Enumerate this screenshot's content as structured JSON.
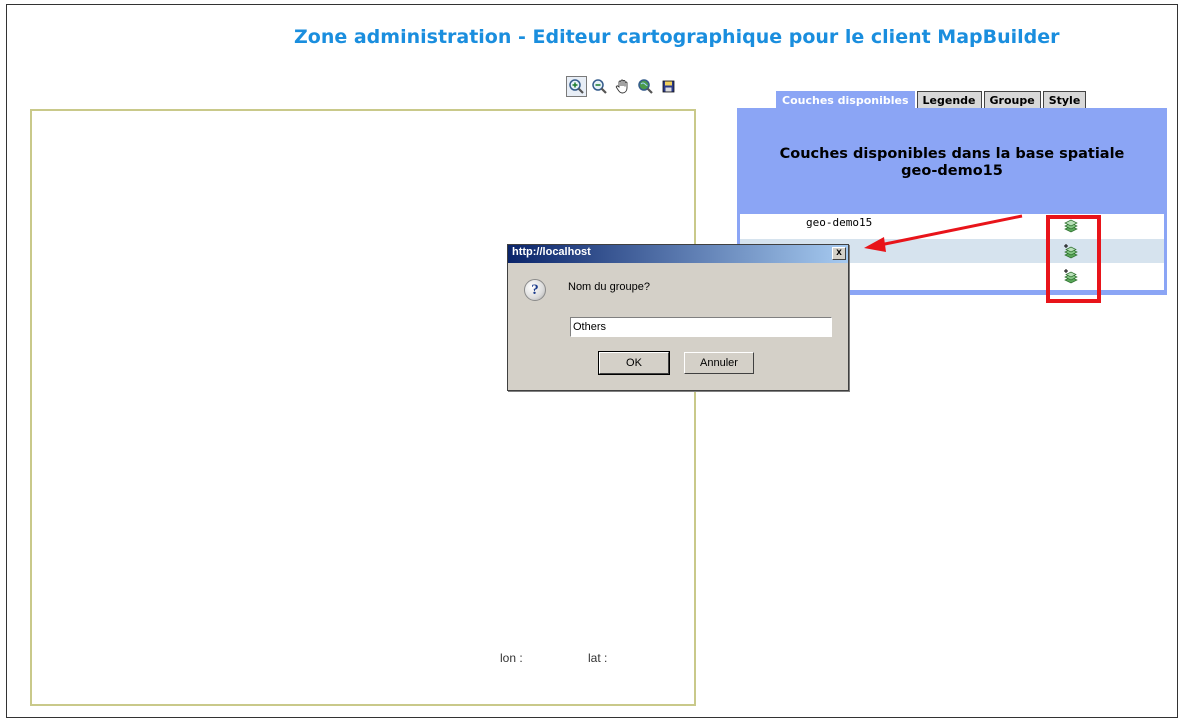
{
  "page": {
    "title": "Zone administration - Editeur cartographique pour le client MapBuilder"
  },
  "toolbar": {
    "tools": [
      "zoom-in-icon",
      "zoom-out-icon",
      "pan-hand-icon",
      "zoom-extent-icon",
      "save-icon"
    ]
  },
  "map": {
    "lon_label": "lon :",
    "lat_label": "lat :"
  },
  "tabs": [
    {
      "label": "Couches disponibles",
      "active": true
    },
    {
      "label": "Legende",
      "active": false
    },
    {
      "label": "Groupe",
      "active": false
    },
    {
      "label": "Style",
      "active": false
    }
  ],
  "panel": {
    "heading_line1": "Couches disponibles dans la base spatiale",
    "heading_line2": "geo-demo15",
    "rows": [
      {
        "label": "geo-demo15",
        "icon": "add-layer-icon"
      },
      {
        "label": "",
        "icon": "add-layer-icon"
      },
      {
        "label": "",
        "icon": "add-layer-icon"
      }
    ]
  },
  "colors": {
    "title": "#1a8ede",
    "panel_bg": "#8ba5f5",
    "row_alt": "#d6e3ee",
    "highlight": "#e8141a",
    "map_border": "#c9c98a"
  },
  "dialog": {
    "title": "http://localhost",
    "message": "Nom du groupe?",
    "input_value": "Others",
    "ok_label": "OK",
    "cancel_label": "Annuler",
    "close_label": "x",
    "icon": "question-icon"
  }
}
